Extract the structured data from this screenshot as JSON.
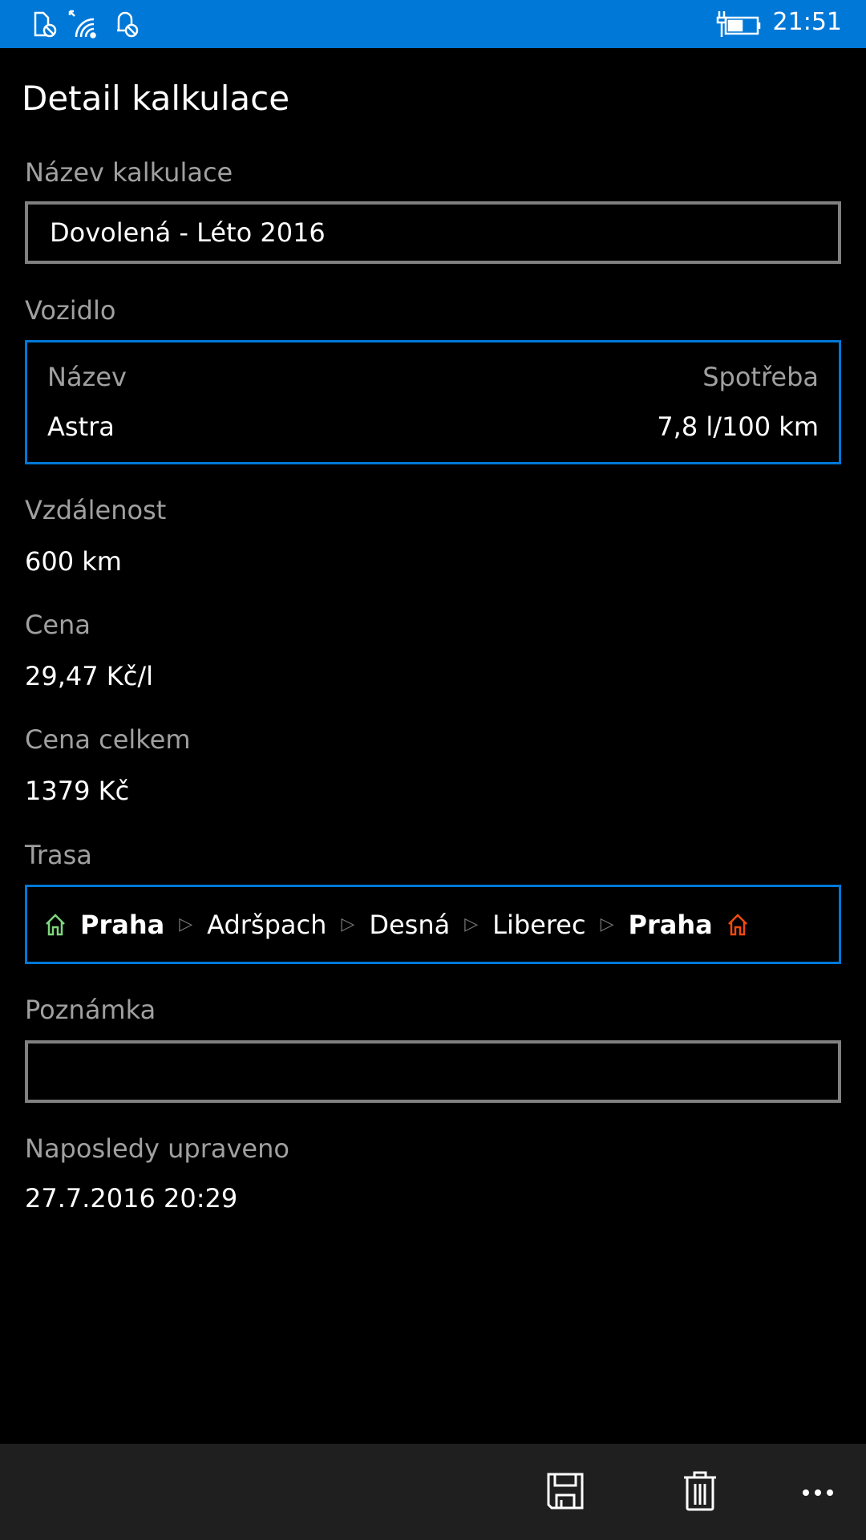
{
  "status": {
    "time": "21:51",
    "icons": [
      "sim-blocked-icon",
      "wifi-icon",
      "notification-blocked-icon",
      "battery-charging-icon"
    ]
  },
  "title": "Detail kalkulace",
  "name": {
    "label": "Název kalkulace",
    "value": "Dovolená - Léto 2016"
  },
  "vehicle": {
    "label": "Vozidlo",
    "name_header": "Název",
    "consumption_header": "Spotřeba",
    "name": "Astra",
    "consumption": "7,8 l/100 km"
  },
  "distance": {
    "label": "Vzdálenost",
    "value": "600 km"
  },
  "price": {
    "label": "Cena",
    "value": "29,47 Kč/l"
  },
  "total": {
    "label": "Cena celkem",
    "value": "1379 Kč"
  },
  "route": {
    "label": "Trasa",
    "stops": [
      "Praha",
      "Adršpach",
      "Desná",
      "Liberec",
      "Praha"
    ],
    "start_color": "#7ed67e",
    "end_color": "#f04a10"
  },
  "note": {
    "label": "Poznámka",
    "value": ""
  },
  "modified": {
    "label": "Naposledy upraveno",
    "value": "27.7.2016 20:29"
  },
  "appbar": {
    "buttons": [
      "save-icon",
      "delete-icon",
      "more-icon"
    ]
  }
}
